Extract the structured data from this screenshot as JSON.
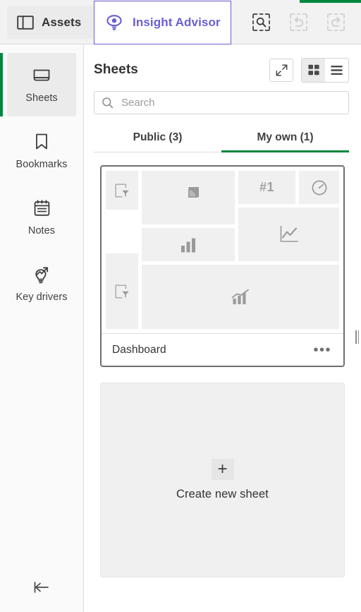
{
  "topbar": {
    "assets_label": "Assets",
    "assets_icon": "panel-layout-icon",
    "insight_advisor_label": "Insight Advisor",
    "insight_advisor_icon": "insight-eye-bulb-icon",
    "accent_color": "#6a5ed6",
    "green_accent_color": "#00873d",
    "actions": [
      {
        "name": "selections-search-icon",
        "enabled": true
      },
      {
        "name": "undo-icon",
        "enabled": false
      },
      {
        "name": "redo-icon",
        "enabled": false
      },
      {
        "name": "clear-selections-icon",
        "enabled": false
      }
    ]
  },
  "sidebar": {
    "items": [
      {
        "label": "Sheets",
        "icon": "sheets-icon",
        "active": true
      },
      {
        "label": "Bookmarks",
        "icon": "bookmark-icon",
        "active": false
      },
      {
        "label": "Notes",
        "icon": "notes-icon",
        "active": false
      },
      {
        "label": "Key drivers",
        "icon": "key-drivers-icon",
        "active": false
      }
    ],
    "collapse_icon": "collapse-left-icon",
    "active_accent_color": "#00873d"
  },
  "main": {
    "title": "Sheets",
    "expand_label": "expand-icon",
    "grid_view_icon": "grid-view-icon",
    "list_view_icon": "list-view-icon",
    "active_view": "grid",
    "search": {
      "placeholder": "Search",
      "value": "",
      "icon": "search-icon"
    },
    "tabs": [
      {
        "label": "Public (3)",
        "active": false
      },
      {
        "label": "My own (1)",
        "active": true
      }
    ],
    "tab_accent_color": "#00873d"
  },
  "sheets": [
    {
      "name": "Dashboard",
      "menu_label": "•••",
      "thumbnail_objects": [
        {
          "type": "filterpane",
          "icon": "filter-pane-icon",
          "region": "left-top"
        },
        {
          "type": "filterpane",
          "icon": "filter-pane-icon",
          "region": "left-bottom"
        },
        {
          "type": "piechart",
          "icon": "pie-chart-icon",
          "region": "upper-left-top"
        },
        {
          "type": "barchart",
          "icon": "bar-chart-icon",
          "region": "upper-left-bottom"
        },
        {
          "type": "kpi",
          "icon": "kpi-icon",
          "label": "#1",
          "region": "upper-right-top-left"
        },
        {
          "type": "gauge",
          "icon": "gauge-icon",
          "region": "upper-right-top-right"
        },
        {
          "type": "linechart",
          "icon": "line-chart-icon",
          "region": "upper-right-bottom"
        },
        {
          "type": "combochart",
          "icon": "combo-chart-icon",
          "region": "bottom-wide"
        }
      ]
    }
  ],
  "create_sheet": {
    "label": "Create new sheet",
    "plus_icon": "plus-icon"
  },
  "resize_handle": {
    "name": "panel-resize-handle"
  }
}
